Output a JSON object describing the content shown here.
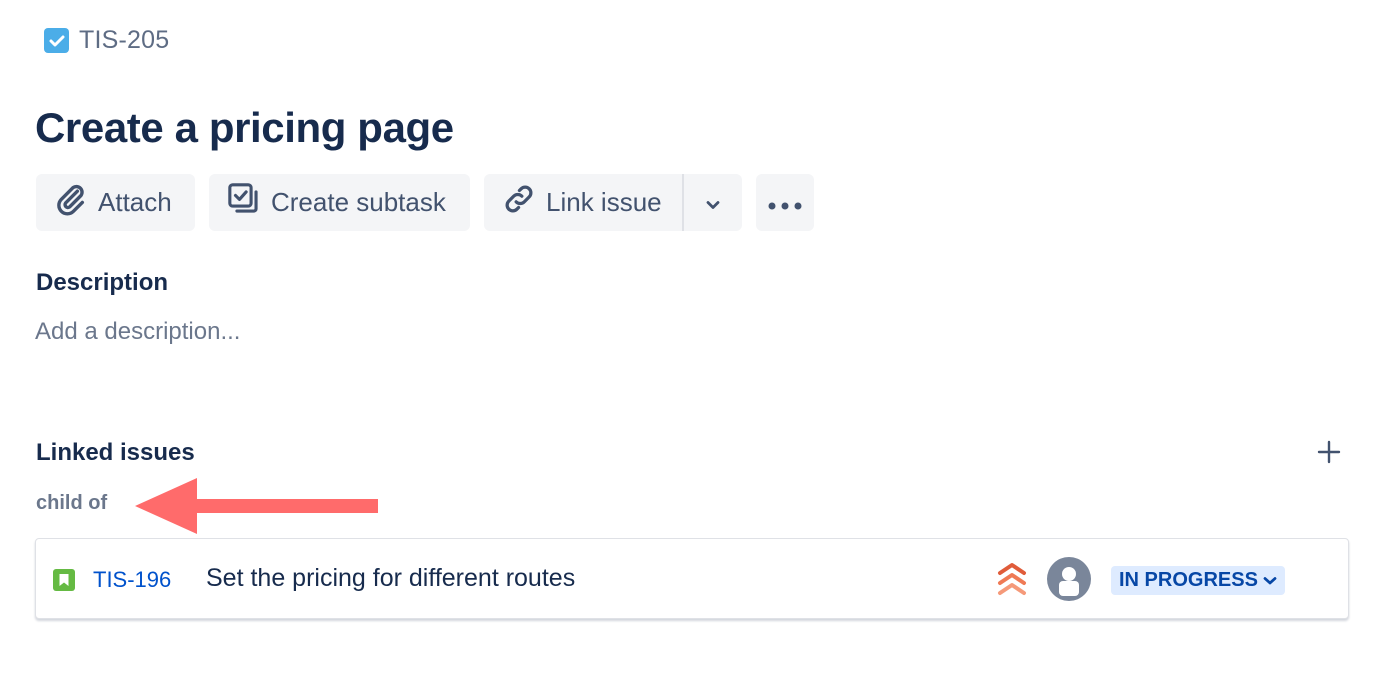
{
  "issue": {
    "type_icon": "task-checkbox-icon",
    "type_color": "#4bade8",
    "key": "TIS-205",
    "title": "Create a pricing page"
  },
  "toolbar": {
    "attach_label": "Attach",
    "attach_icon": "paperclip-icon",
    "create_subtask_label": "Create subtask",
    "create_subtask_icon": "subtask-icon",
    "link_issue_label": "Link issue",
    "link_issue_icon": "link-icon",
    "dropdown_icon": "chevron-down-icon",
    "more_icon": "more-horizontal-icon"
  },
  "description": {
    "label": "Description",
    "placeholder": "Add a description..."
  },
  "linked_issues": {
    "label": "Linked issues",
    "add_icon": "plus-icon",
    "groups": [
      {
        "relation": "child of",
        "issues": [
          {
            "type_icon": "story-bookmark-icon",
            "type_color": "#65ba43",
            "key": "TIS-196",
            "summary": "Set the pricing for different routes",
            "priority": "Highest",
            "priority_icon": "priority-highest-icon",
            "priority_color": "#ff5630",
            "assignee": "Unassigned",
            "status": "IN PROGRESS",
            "status_bg": "#deebff",
            "status_color": "#0747a6"
          }
        ]
      }
    ]
  },
  "annotation": {
    "type": "arrow",
    "color": "#ff6b6b",
    "points_to": "child of"
  }
}
